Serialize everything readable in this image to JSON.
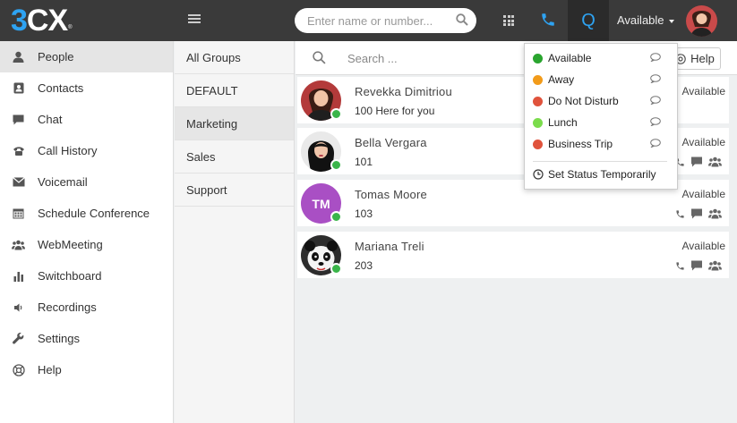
{
  "app": {
    "logo": {
      "three": "3",
      "cx": "CX",
      "reg": "®"
    },
    "search": {
      "placeholder": "Enter name or number..."
    },
    "q_label": "Q",
    "status_label": "Available"
  },
  "sidebar": {
    "items": [
      {
        "label": "People",
        "icon": "person-icon"
      },
      {
        "label": "Contacts",
        "icon": "contact-card-icon"
      },
      {
        "label": "Chat",
        "icon": "chat-icon"
      },
      {
        "label": "Call History",
        "icon": "phone-history-icon"
      },
      {
        "label": "Voicemail",
        "icon": "envelope-icon"
      },
      {
        "label": "Schedule Conference",
        "icon": "calendar-icon"
      },
      {
        "label": "WebMeeting",
        "icon": "group-icon"
      },
      {
        "label": "Switchboard",
        "icon": "bar-chart-icon"
      },
      {
        "label": "Recordings",
        "icon": "speaker-icon"
      },
      {
        "label": "Settings",
        "icon": "wrench-icon"
      },
      {
        "label": "Help",
        "icon": "lifebuoy-icon"
      }
    ]
  },
  "groups": {
    "items": [
      "All Groups",
      "DEFAULT",
      "Marketing",
      "Sales",
      "Support"
    ]
  },
  "main": {
    "search_placeholder": "Search ...",
    "help_label": "Help"
  },
  "contacts": [
    {
      "name": "Revekka Dimitriou",
      "ext": "100  Here for you",
      "status": "Available"
    },
    {
      "name": "Bella Vergara",
      "ext": "101",
      "status": "Available"
    },
    {
      "name": "Tomas Moore",
      "initials": "TM",
      "ext": "103",
      "status": "Available"
    },
    {
      "name": "Mariana Treli",
      "ext": "203",
      "status": "Available"
    }
  ],
  "status_menu": {
    "items": [
      {
        "label": "Available",
        "color": "#2aa52f"
      },
      {
        "label": "Away",
        "color": "#f29b1a"
      },
      {
        "label": "Do Not Disturb",
        "color": "#e0533c"
      },
      {
        "label": "Lunch",
        "color": "#7bdc4c"
      },
      {
        "label": "Business Trip",
        "color": "#e0533c"
      }
    ],
    "temporary": "Set Status Temporarily"
  },
  "colors": {
    "accent": "#2ea3f2",
    "topbar": "#3a3a3a",
    "online": "#3ab54a"
  }
}
